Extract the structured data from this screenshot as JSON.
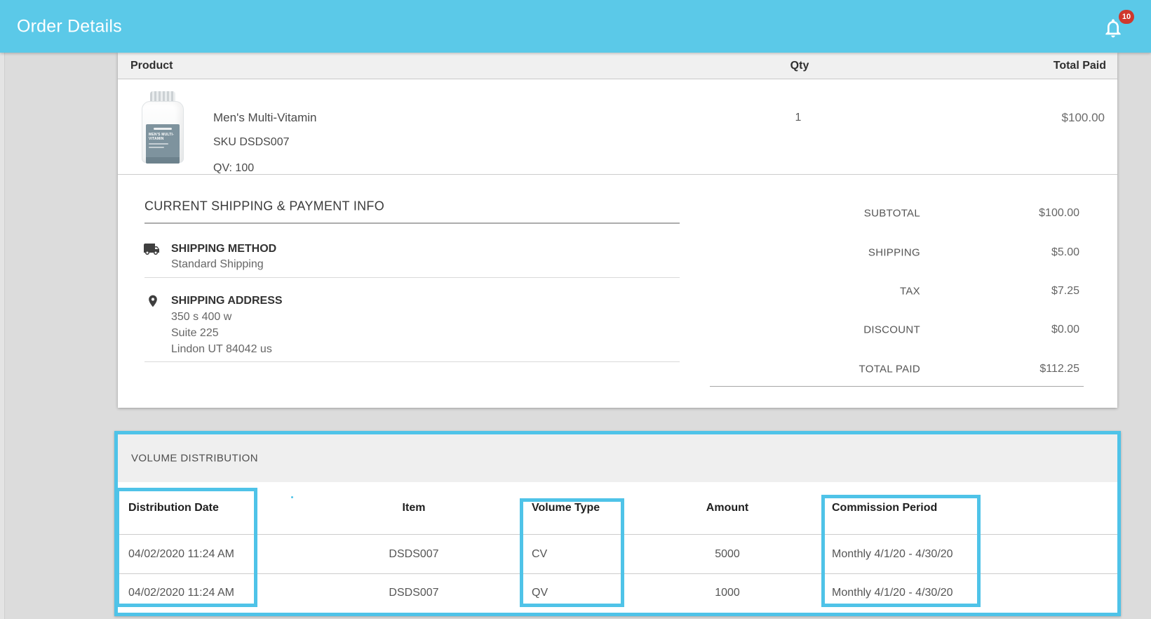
{
  "app_bar": {
    "title": "Order Details",
    "notification_count": "10"
  },
  "order_items": {
    "columns": {
      "product": "Product",
      "qty": "Qty",
      "total_paid": "Total Paid"
    },
    "items": [
      {
        "name": "Men's Multi-Vitamin",
        "sku": "SKU DSDS007",
        "qv": "QV: 100",
        "qty": "1",
        "total_paid": "$100.00",
        "bottle_label": "MEN'S MULTI-VITAMIN"
      }
    ]
  },
  "shipping_info": {
    "heading": "CURRENT SHIPPING & PAYMENT INFO",
    "shipping_method": {
      "label": "SHIPPING METHOD",
      "value": "Standard Shipping",
      "icon": "truck-icon"
    },
    "shipping_address": {
      "label": "SHIPPING ADDRESS",
      "icon": "location-pin-icon",
      "lines": [
        "350 s 400 w",
        "Suite 225",
        "Lindon UT 84042 us"
      ]
    }
  },
  "order_summary": {
    "rows": [
      {
        "label": "SUBTOTAL",
        "value": "$100.00"
      },
      {
        "label": "SHIPPING",
        "value": "$5.00"
      },
      {
        "label": "TAX",
        "value": "$7.25"
      },
      {
        "label": "DISCOUNT",
        "value": "$0.00"
      },
      {
        "label": "TOTAL PAID",
        "value": "$112.25"
      }
    ]
  },
  "volume_distribution": {
    "heading": "VOLUME DISTRIBUTION",
    "columns": [
      "Distribution Date",
      "Item",
      "Volume Type",
      "Amount",
      "Commission Period"
    ],
    "rows": [
      {
        "distribution_date": "04/02/2020 11:24 AM",
        "item": "DSDS007",
        "volume_type": "CV",
        "amount": "5000",
        "commission_period": "Monthly 4/1/20 - 4/30/20"
      },
      {
        "distribution_date": "04/02/2020 11:24 AM",
        "item": "DSDS007",
        "volume_type": "QV",
        "amount": "1000",
        "commission_period": "Monthly 4/1/20 - 4/30/20"
      }
    ],
    "highlighted_columns": [
      "Distribution Date",
      "Volume Type",
      "Commission Period"
    ]
  },
  "colors": {
    "app_bar_blue": "#5bc9e8",
    "highlight_blue": "#4fc3e8",
    "badge_red": "#cf382d",
    "page_background": "#dcdcdc"
  }
}
